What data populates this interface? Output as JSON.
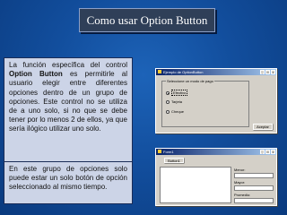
{
  "title": "Como usar Option Button",
  "textbox1": {
    "part1": "La función específica del control ",
    "bold": "Option Button",
    "part2": " es permitirle al usuario elegir entre diferentes opciones dentro de un grupo de opciones. Este control no se utiliza de a uno solo, si no que se debe tener por lo menos 2 de ellos, ya que sería ilógico utilizar uno solo."
  },
  "textbox2": "En este grupo de opciones solo puede estar un solo botón de opción seleccionado al mismo tiempo.",
  "window1": {
    "title": "Ejemplo de OptionButton",
    "group_label": "Seleccione un modo de pago",
    "options": [
      {
        "label": "Efectivo",
        "selected": true
      },
      {
        "label": "Tarjeta",
        "selected": false
      },
      {
        "label": "Cheque",
        "selected": false
      }
    ],
    "accept_label": "Aceptar"
  },
  "window2": {
    "title": "Form1",
    "button_label": "Button1",
    "fields": [
      {
        "label": "Menor:"
      },
      {
        "label": "Mayor:"
      },
      {
        "label": "Promedio:"
      }
    ]
  },
  "colors": {
    "background": "#124e9d",
    "textbox": "#ccd4e7",
    "title_bar": "#2f3f58"
  }
}
